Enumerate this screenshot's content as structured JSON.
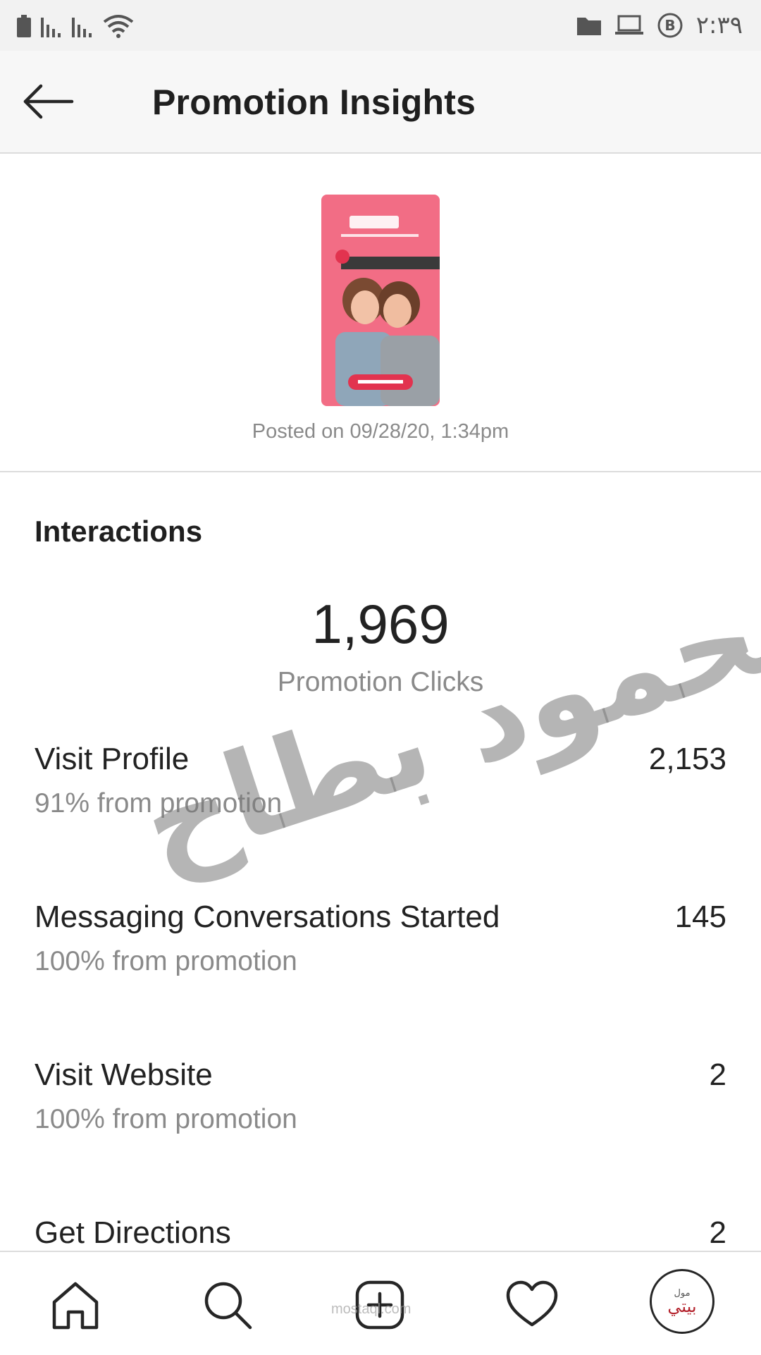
{
  "status_bar": {
    "time": "٢:٣٩"
  },
  "header": {
    "title": "Promotion Insights"
  },
  "post": {
    "posted_on": "Posted on 09/28/20, 1:34pm"
  },
  "interactions": {
    "section_title": "Interactions",
    "total_value": "1,969",
    "total_label": "Promotion Clicks",
    "metrics": [
      {
        "label": "Visit Profile",
        "value": "2,153",
        "sub": "91% from promotion"
      },
      {
        "label": "Messaging Conversations Started",
        "value": "145",
        "sub": "100% from promotion"
      },
      {
        "label": "Visit Website",
        "value": "2",
        "sub": "100% from promotion"
      },
      {
        "label": "Get Directions",
        "value": "2"
      }
    ]
  },
  "watermark": {
    "text": "محمود بطاح"
  },
  "bottom_nav": {
    "items": [
      "home-icon",
      "search-icon",
      "new-post-icon",
      "activity-icon",
      "profile-avatar"
    ],
    "avatar_text": "بيتي",
    "avatar_small": "مول",
    "overlay_text": "mostaql.com"
  },
  "colors": {
    "accent_pink": "#f0647f",
    "brand_red": "#b3202a",
    "muted_text": "#8a8a8a"
  }
}
